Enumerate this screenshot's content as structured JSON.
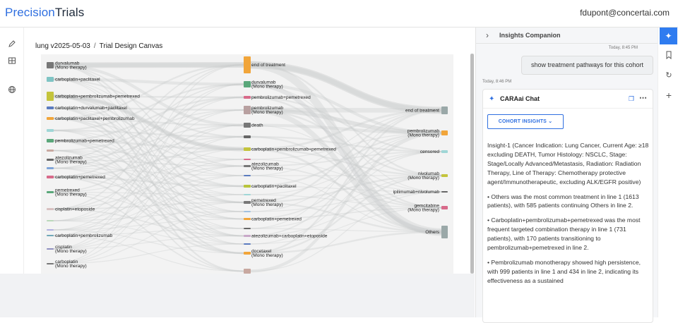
{
  "header": {
    "brand_part1": "Precision",
    "brand_part2": "Trials",
    "user_email": "fdupont@concertai.com"
  },
  "left_rail": {
    "icons": [
      "pen-icon",
      "map-icon",
      "globe-icon"
    ]
  },
  "breadcrumb": {
    "project": "lung v2025-05-03",
    "separator": "/",
    "page": "Trial Design Canvas"
  },
  "sankey": {
    "column1": [
      {
        "label": "durvalumab (Mono therapy)",
        "color": "#777777"
      },
      {
        "label": "carboplatin+paclitaxel",
        "color": "#7fc4c4"
      },
      {
        "label": "carboplatin+pembrolizumab+pemetrexed",
        "color": "#c4c43c"
      },
      {
        "label": "carboplatin+durvalumab+paclitaxel",
        "color": "#5b7bbf"
      },
      {
        "label": "carboplatin+paclitaxel+pembrolizumab",
        "color": "#f1a53a"
      },
      {
        "label": "",
        "color": "#9fd6d6"
      },
      {
        "label": "pembrolizumab+pemetrexed",
        "color": "#5aa77a"
      },
      {
        "label": "",
        "color": "#c8a8a0"
      },
      {
        "label": "atezolizumab (Mono therapy)",
        "color": "#666666"
      },
      {
        "label": "",
        "color": "#7fa4d8"
      },
      {
        "label": "carboplatin+pemetrexed",
        "color": "#d86a8a"
      },
      {
        "label": "pemetrexed (Mono therapy)",
        "color": "#5aa77a"
      },
      {
        "label": "cisplatin+etoposide",
        "color": "#d8c0c0"
      },
      {
        "label": "",
        "color": "#b9d8b9"
      },
      {
        "label": "",
        "color": "#b0b0e0"
      },
      {
        "label": "carboplatin+pembrolizumab",
        "color": "#6fa8b8"
      },
      {
        "label": "cisplatin (Mono therapy)",
        "color": "#9090c0"
      },
      {
        "label": "carboplatin (Mono therapy)",
        "color": "#777777"
      }
    ],
    "column2": [
      {
        "label": "end of treatment",
        "color": "#f1a53a"
      },
      {
        "label": "durvalumab (Mono therapy)",
        "color": "#5aa77a"
      },
      {
        "label": "pembrolizumab+pemetrexed",
        "color": "#d86a8a"
      },
      {
        "label": "pembrolizumab (Mono therapy)",
        "color": "#b8a0a0"
      },
      {
        "label": "death",
        "color": "#777777"
      },
      {
        "label": "",
        "color": "#666666"
      },
      {
        "label": "carboplatin+pembrolizumab+pemetrexed",
        "color": "#c4c43c"
      },
      {
        "label": "",
        "color": "#d86a8a"
      },
      {
        "label": "atezolizumab (Mono therapy)",
        "color": "#777777"
      },
      {
        "label": "",
        "color": "#5b7bbf"
      },
      {
        "label": "carboplatin+paclitaxel",
        "color": "#b8c43c"
      },
      {
        "label": "",
        "color": "#9fd6d6"
      },
      {
        "label": "pemetrexed (Mono therapy)",
        "color": "#777777"
      },
      {
        "label": "",
        "color": "#a0c0e0"
      },
      {
        "label": "carboplatin+pemetrexed",
        "color": "#f1a53a"
      },
      {
        "label": "",
        "color": "#666666"
      },
      {
        "label": "atezolizumab+carboplatin+etoposide",
        "color": "#c8a8c8"
      },
      {
        "label": "",
        "color": "#5b7bbf"
      },
      {
        "label": "docetaxel (Mono therapy)",
        "color": "#f1a53a"
      },
      {
        "label": "",
        "color": "#c8a8a0"
      }
    ],
    "column3": [
      {
        "label": "end of treatment",
        "color": "#9aa8a8"
      },
      {
        "label": "pembrolizumab (Mono therapy)",
        "color": "#f1a53a"
      },
      {
        "label": "censored",
        "color": "#9fd6d6"
      },
      {
        "label": "nivolumab (Mono therapy)",
        "color": "#c4c43c"
      },
      {
        "label": "ipilimumab+nivolumab",
        "color": "#666666"
      },
      {
        "label": "gemcitabine (Mono therapy)",
        "color": "#d86a8a"
      },
      {
        "label": "Others",
        "color": "#9aa8a8"
      }
    ]
  },
  "insights_panel": {
    "title": "Insights Companion",
    "user_timestamp": "Today, 8:45 PM",
    "user_message": "show treatment pathways for this cohort",
    "reply_timestamp": "Today, 8:46 PM",
    "chat_title": "CARAai Chat",
    "cohort_button": "COHORT INSIGHTS",
    "insight_intro": "Insight-1 (Cancer Indication: Lung Cancer, Current Age: ≥18 excluding DEATH, Tumor Histology: NSCLC, Stage: Stage/Locally Advanced/Metastasis, Radiation: Radiation Therapy, Line of Therapy: Chemotherapy protective agent/Immunotherapeutic, excluding ALK/EGFR positive)",
    "bullets": [
      "• Others was the most common treatment in line 1 (1613 patients), with 585 patients continuing Others in line 2.",
      "• Carboplatin+pembrolizumab+pemetrexed was the most frequent targeted combination therapy in line 1 (731 patients), with 170 patients transitioning to pembrolizumab+pemetrexed in line 2.",
      "• Pembrolizumab monotherapy showed high persistence, with 999 patients in line 1 and 434 in line 2, indicating its effectiveness as a sustained"
    ]
  },
  "right_rail": {
    "icons": [
      "sparkle-icon",
      "bookmark-icon",
      "refresh-icon",
      "plus-icon"
    ]
  }
}
